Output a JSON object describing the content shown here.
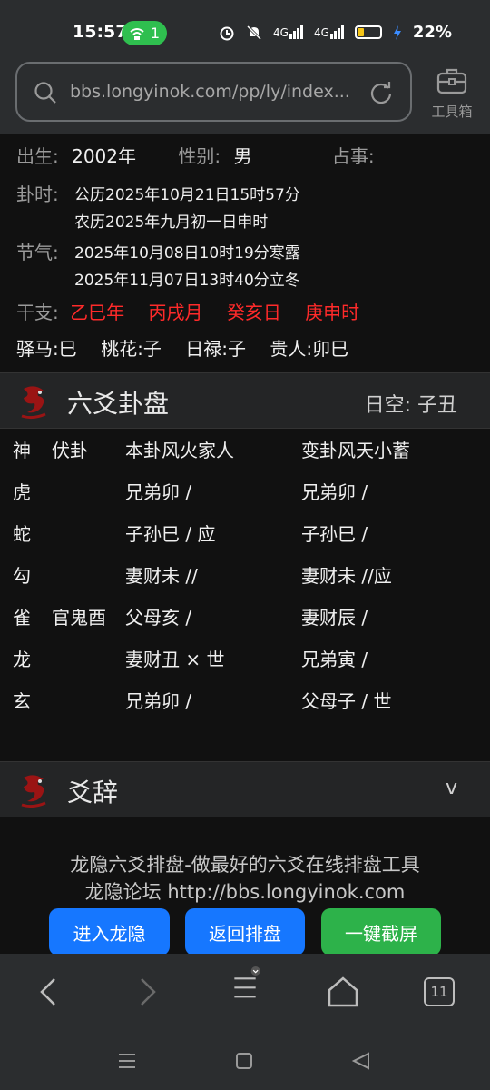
{
  "status": {
    "time": "15:57",
    "hotspot_count": "1",
    "net1": "4G",
    "net2": "4G",
    "battery": "22%"
  },
  "browser": {
    "url": "bbs.longyinok.com/pp/ly/index...",
    "toolbox_label": "工具箱"
  },
  "info": {
    "birth_label": "出生:",
    "birth_value": "2002年",
    "gender_label": "性别:",
    "gender_value": "男",
    "divine_label": "占事:",
    "time_label": "卦时:",
    "time_line1": "公历2025年10月21日15时57分",
    "time_line2": "农历2025年九月初一日申时",
    "term_label": "节气:",
    "term_line1": "2025年10月08日10时19分寒露",
    "term_line2": "2025年11月07日13时40分立冬",
    "ganzhi_label": "干支:",
    "ganzhi": [
      "乙巳年",
      "丙戌月",
      "癸亥日",
      "庚申时"
    ],
    "shensha": [
      "驿马:巳",
      "桃花:子",
      "日禄:子",
      "贵人:卯巳"
    ]
  },
  "panel": {
    "title": "六爻卦盘",
    "kongwang": "日空:  子丑",
    "headers": [
      "神",
      "伏卦",
      "本卦风火家人",
      "变卦风天小蓄"
    ],
    "rows": [
      {
        "god": "虎",
        "fu": "",
        "ben": "兄弟卯  /",
        "bian": "兄弟卯  /"
      },
      {
        "god": "蛇",
        "fu": "",
        "ben": "子孙巳  / 应",
        "bian": "子孙巳  /"
      },
      {
        "god": "勾",
        "fu": "",
        "ben": "妻财未 //",
        "bian": "妻财未 //应"
      },
      {
        "god": "雀",
        "fu": "官鬼酉",
        "ben": "父母亥  /",
        "bian": "妻财辰  /"
      },
      {
        "god": "龙",
        "fu": "",
        "ben": "妻财丑 × 世",
        "bian": "兄弟寅  /"
      },
      {
        "god": "玄",
        "fu": "",
        "ben": "兄弟卯  /",
        "bian": "父母子  / 世"
      }
    ]
  },
  "yaoci": {
    "title": "爻辞",
    "chevron": "v"
  },
  "footer": {
    "line1": "龙隐六爻排盘-做最好的六爻在线排盘工具",
    "line2": "龙隐论坛 http://bbs.longyinok.com",
    "btn_enter": "进入龙隐",
    "btn_back": "返回排盘",
    "btn_shot": "一键截屏"
  },
  "navbar": {
    "tabs_count": "11"
  },
  "colors": {
    "red": "#ff2a2a",
    "blue": "#1677ff",
    "green": "#2db24a"
  }
}
